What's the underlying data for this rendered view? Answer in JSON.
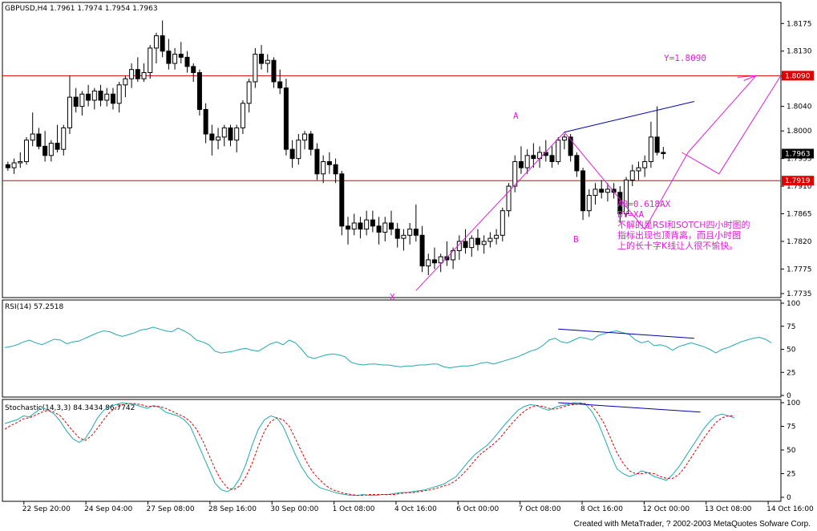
{
  "footer": "Created with MetaTrader, ? 2002-2003 MetaQuotes Sofware Corp.",
  "colors": {
    "background": "#ffffff",
    "candle": "#000000",
    "resistance": "#e00000",
    "trendline": "#0000aa",
    "pattern": "#e020d8",
    "rsi": "#22a8b0",
    "stoch_main": "#22a8b0",
    "stoch_signal": "#e00000"
  },
  "chart_data": [
    {
      "type": "candlestick",
      "title": "GBPUSD,H4  1.7961 1.7974 1.7954 1.7963",
      "y_ticks": [
        "1.8175",
        "1.8130",
        "1.8090",
        "1.8040",
        "1.8000",
        "1.7955",
        "1.7910",
        "1.7865",
        "1.7820",
        "1.7775",
        "1.7735"
      ],
      "ylim": [
        1.7735,
        1.8195
      ],
      "x_ticks": [
        "22 Sep 20:00",
        "24 Sep 04:00",
        "27 Sep 08:00",
        "28 Sep 16:00",
        "30 Sep 00:00",
        "1 Oct 08:00",
        "4 Oct 16:00",
        "6 Oct 00:00",
        "7 Oct 08:00",
        "8 Oct 16:00",
        "12 Oct 00:00",
        "13 Oct 08:00",
        "14 Oct 16:00"
      ],
      "horizontal_lines": [
        {
          "label": "1.8090",
          "value": 1.809
        },
        {
          "label": "1.7919",
          "value": 1.7919
        }
      ],
      "current_price": "1.7963",
      "pattern_points": [
        "X",
        "A",
        "B"
      ],
      "target_label": "Y=1.8090",
      "annotation_lines": [
        "AB=0.618AX",
        "BY=XA",
        "不解的是RSI和SOTCH四小时图的",
        "指标出现也顶背离，而且小时图",
        "上的长十字K线让人很不愉快。"
      ],
      "candles": [
        [
          1.7945,
          1.795,
          1.7935,
          1.794
        ],
        [
          1.794,
          1.7955,
          1.793,
          1.7948
        ],
        [
          1.7948,
          1.7965,
          1.794,
          1.795
        ],
        [
          1.795,
          1.799,
          1.7945,
          1.7985
        ],
        [
          1.7985,
          1.803,
          1.7975,
          1.7995
        ],
        [
          1.7995,
          1.8005,
          1.797,
          1.7975
        ],
        [
          1.7975,
          1.8,
          1.795,
          1.796
        ],
        [
          1.796,
          1.7985,
          1.795,
          1.798
        ],
        [
          1.798,
          1.801,
          1.7965,
          1.797
        ],
        [
          1.797,
          1.801,
          1.796,
          1.8005
        ],
        [
          1.8005,
          1.809,
          1.7995,
          1.8055
        ],
        [
          1.8055,
          1.807,
          1.803,
          1.804
        ],
        [
          1.804,
          1.8065,
          1.8025,
          1.806
        ],
        [
          1.806,
          1.8075,
          1.804,
          1.805
        ],
        [
          1.805,
          1.807,
          1.8035,
          1.8065
        ],
        [
          1.8065,
          1.8075,
          1.804,
          1.805
        ],
        [
          1.805,
          1.807,
          1.804,
          1.806
        ],
        [
          1.806,
          1.807,
          1.8035,
          1.8045
        ],
        [
          1.8045,
          1.808,
          1.803,
          1.8075
        ],
        [
          1.8075,
          1.809,
          1.8055,
          1.8085
        ],
        [
          1.8085,
          1.811,
          1.807,
          1.81
        ],
        [
          1.81,
          1.812,
          1.808,
          1.8085
        ],
        [
          1.8085,
          1.811,
          1.808,
          1.8095
        ],
        [
          1.8095,
          1.814,
          1.8085,
          1.8135
        ],
        [
          1.8135,
          1.816,
          1.811,
          1.8155
        ],
        [
          1.8155,
          1.818,
          1.812,
          1.813
        ],
        [
          1.813,
          1.815,
          1.81,
          1.811
        ],
        [
          1.811,
          1.8135,
          1.81,
          1.8125
        ],
        [
          1.8125,
          1.8145,
          1.811,
          1.812
        ],
        [
          1.812,
          1.813,
          1.8095,
          1.8105
        ],
        [
          1.8105,
          1.811,
          1.808,
          1.8095
        ],
        [
          1.8095,
          1.81,
          1.8025,
          1.8035
        ],
        [
          1.8035,
          1.8045,
          1.798,
          1.7995
        ],
        [
          1.7995,
          1.801,
          1.796,
          1.7985
        ],
        [
          1.7985,
          1.8005,
          1.797,
          1.799
        ],
        [
          1.799,
          1.801,
          1.7975,
          1.8005
        ],
        [
          1.8005,
          1.801,
          1.7975,
          1.7985
        ],
        [
          1.7985,
          1.801,
          1.7965,
          1.8005
        ],
        [
          1.8005,
          1.805,
          1.7995,
          1.8045
        ],
        [
          1.8045,
          1.8085,
          1.803,
          1.808
        ],
        [
          1.808,
          1.8135,
          1.807,
          1.8125
        ],
        [
          1.8125,
          1.814,
          1.81,
          1.811
        ],
        [
          1.811,
          1.8125,
          1.8095,
          1.8115
        ],
        [
          1.8115,
          1.812,
          1.807,
          1.808
        ],
        [
          1.808,
          1.81,
          1.806,
          1.807
        ],
        [
          1.807,
          1.8085,
          1.796,
          1.797
        ],
        [
          1.797,
          1.7985,
          1.794,
          1.7955
        ],
        [
          1.7955,
          1.7995,
          1.7945,
          1.7985
        ],
        [
          1.7985,
          1.8,
          1.797,
          1.7995
        ],
        [
          1.7995,
          1.8,
          1.796,
          1.797
        ],
        [
          1.797,
          1.798,
          1.792,
          1.793
        ],
        [
          1.793,
          1.796,
          1.7915,
          1.795
        ],
        [
          1.795,
          1.7965,
          1.793,
          1.7945
        ],
        [
          1.7945,
          1.7955,
          1.7915,
          1.793
        ],
        [
          1.793,
          1.7935,
          1.783,
          1.7845
        ],
        [
          1.7845,
          1.786,
          1.7815,
          1.784
        ],
        [
          1.784,
          1.7865,
          1.783,
          1.785
        ],
        [
          1.785,
          1.786,
          1.7825,
          1.784
        ],
        [
          1.784,
          1.787,
          1.783,
          1.7855
        ],
        [
          1.7855,
          1.787,
          1.7835,
          1.7845
        ],
        [
          1.7845,
          1.786,
          1.7815,
          1.7835
        ],
        [
          1.7835,
          1.786,
          1.782,
          1.785
        ],
        [
          1.785,
          1.787,
          1.783,
          1.784
        ],
        [
          1.784,
          1.785,
          1.781,
          1.7825
        ],
        [
          1.7825,
          1.784,
          1.7805,
          1.783
        ],
        [
          1.783,
          1.785,
          1.7815,
          1.784
        ],
        [
          1.784,
          1.788,
          1.782,
          1.783
        ],
        [
          1.783,
          1.7845,
          1.777,
          1.778
        ],
        [
          1.778,
          1.78,
          1.7765,
          1.779
        ],
        [
          1.779,
          1.781,
          1.7775,
          1.7785
        ],
        [
          1.7785,
          1.78,
          1.777,
          1.7795
        ],
        [
          1.7795,
          1.782,
          1.778,
          1.779
        ],
        [
          1.779,
          1.781,
          1.7775,
          1.7805
        ],
        [
          1.7805,
          1.783,
          1.779,
          1.782
        ],
        [
          1.782,
          1.784,
          1.78,
          1.781
        ],
        [
          1.781,
          1.783,
          1.7795,
          1.7825
        ],
        [
          1.7825,
          1.784,
          1.7805,
          1.7815
        ],
        [
          1.7815,
          1.783,
          1.78,
          1.782
        ],
        [
          1.782,
          1.7835,
          1.781,
          1.7825
        ],
        [
          1.7825,
          1.784,
          1.7815,
          1.783
        ],
        [
          1.783,
          1.7875,
          1.782,
          1.787
        ],
        [
          1.787,
          1.7915,
          1.786,
          1.791
        ],
        [
          1.791,
          1.796,
          1.79,
          1.795
        ],
        [
          1.795,
          1.7975,
          1.793,
          1.794
        ],
        [
          1.794,
          1.797,
          1.793,
          1.796
        ],
        [
          1.796,
          1.798,
          1.794,
          1.7955
        ],
        [
          1.7955,
          1.7975,
          1.794,
          1.7965
        ],
        [
          1.7965,
          1.7985,
          1.795,
          1.796
        ],
        [
          1.796,
          1.7975,
          1.794,
          1.795
        ],
        [
          1.795,
          1.799,
          1.7945,
          1.7985
        ],
        [
          1.7985,
          1.7995,
          1.797,
          1.799
        ],
        [
          1.799,
          1.7995,
          1.795,
          1.796
        ],
        [
          1.796,
          1.7965,
          1.7925,
          1.7935
        ],
        [
          1.7935,
          1.794,
          1.7855,
          1.787
        ],
        [
          1.787,
          1.7905,
          1.786,
          1.7895
        ],
        [
          1.7895,
          1.7915,
          1.788,
          1.7905
        ],
        [
          1.7905,
          1.792,
          1.789,
          1.79
        ],
        [
          1.79,
          1.7915,
          1.7885,
          1.7905
        ],
        [
          1.7905,
          1.7915,
          1.789,
          1.79
        ],
        [
          1.79,
          1.791,
          1.785,
          1.7865
        ],
        [
          1.7865,
          1.7925,
          1.786,
          1.792
        ],
        [
          1.792,
          1.7945,
          1.791,
          1.7935
        ],
        [
          1.7935,
          1.795,
          1.792,
          1.794
        ],
        [
          1.794,
          1.796,
          1.7925,
          1.795
        ],
        [
          1.795,
          1.8015,
          1.794,
          1.799
        ],
        [
          1.799,
          1.804,
          1.796,
          1.7965
        ],
        [
          1.7965,
          1.7974,
          1.7954,
          1.7963
        ]
      ]
    },
    {
      "type": "line",
      "title": "RSI(14)  57.2518",
      "y_ticks": [
        "100",
        "75",
        "50",
        "25",
        "0"
      ],
      "ylim": [
        0,
        100
      ],
      "values": [
        52,
        53,
        55,
        58,
        60,
        57,
        55,
        58,
        61,
        60,
        56,
        58,
        59,
        62,
        65,
        68,
        70,
        69,
        66,
        64,
        66,
        68,
        71,
        72,
        74,
        72,
        70,
        69,
        73,
        70,
        66,
        60,
        58,
        55,
        48,
        46,
        47,
        48,
        50,
        51,
        49,
        48,
        52,
        56,
        58,
        55,
        60,
        57,
        50,
        42,
        40,
        42,
        44,
        45,
        44,
        42,
        36,
        34,
        33,
        34,
        34,
        33,
        33,
        32,
        31,
        32,
        32,
        33,
        33,
        34,
        34,
        31,
        30,
        31,
        32,
        32,
        33,
        35,
        36,
        34,
        36,
        38,
        40,
        42,
        45,
        48,
        50,
        54,
        60,
        62,
        58,
        57,
        60,
        63,
        62,
        60,
        65,
        67,
        69,
        70,
        68,
        66,
        60,
        57,
        59,
        54,
        55,
        53,
        49,
        53,
        55,
        57,
        55,
        53,
        50,
        46,
        50,
        52,
        55,
        58,
        60,
        62,
        63,
        61,
        57
      ]
    },
    {
      "type": "line",
      "title": "Stochastic(14,3,3)  84.3434  86.7742",
      "y_ticks": [
        "100",
        "75",
        "50",
        "25",
        "0"
      ],
      "ylim": [
        0,
        100
      ],
      "series": [
        {
          "values": [
            78,
            80,
            82,
            86,
            85,
            90,
            95,
            92,
            88,
            80,
            70,
            62,
            58,
            62,
            72,
            84,
            92,
            96,
            98,
            100,
            99,
            98,
            96,
            94,
            97,
            95,
            90,
            88,
            86,
            82,
            75,
            60,
            45,
            30,
            15,
            8,
            6,
            10,
            20,
            35,
            55,
            72,
            82,
            86,
            84,
            75,
            60,
            45,
            32,
            22,
            15,
            10,
            8,
            6,
            4,
            3,
            2,
            2,
            3,
            2,
            2,
            3,
            3,
            4,
            5,
            5,
            6,
            7,
            8,
            10,
            12,
            14,
            18,
            22,
            30,
            38,
            45,
            50,
            55,
            62,
            70,
            78,
            85,
            92,
            96,
            98,
            97,
            94,
            92,
            95,
            97,
            98,
            100,
            100,
            98,
            90,
            78,
            62,
            45,
            30,
            25,
            22,
            24,
            28,
            26,
            22,
            20,
            18,
            24,
            32,
            42,
            52,
            62,
            72,
            80,
            86,
            88,
            86,
            84
          ]
        },
        {
          "values": [
            72,
            76,
            79,
            83,
            84,
            87,
            90,
            92,
            90,
            86,
            78,
            70,
            63,
            60,
            65,
            73,
            82,
            90,
            95,
            98,
            99,
            99,
            98,
            96,
            96,
            96,
            94,
            91,
            88,
            85,
            80,
            72,
            60,
            45,
            30,
            18,
            10,
            8,
            12,
            22,
            36,
            54,
            70,
            80,
            84,
            82,
            75,
            62,
            48,
            35,
            25,
            18,
            12,
            8,
            6,
            4,
            3,
            2,
            2,
            3,
            3,
            3,
            3,
            3,
            4,
            5,
            5,
            6,
            7,
            8,
            10,
            12,
            14,
            18,
            24,
            31,
            39,
            46,
            51,
            56,
            62,
            70,
            78,
            85,
            91,
            95,
            97,
            96,
            94,
            93,
            95,
            97,
            98,
            99,
            99,
            96,
            88,
            77,
            62,
            47,
            36,
            28,
            25,
            25,
            26,
            25,
            22,
            20,
            20,
            24,
            32,
            42,
            52,
            62,
            71,
            79,
            84,
            86,
            86
          ]
        }
      ]
    }
  ]
}
